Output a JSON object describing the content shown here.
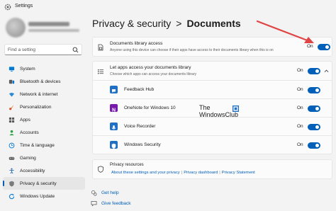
{
  "window": {
    "title": "Settings"
  },
  "search": {
    "placeholder": "Find a setting"
  },
  "nav": {
    "items": [
      {
        "label": "System",
        "icon": "monitor-icon"
      },
      {
        "label": "Bluetooth & devices",
        "icon": "bluetooth-icon"
      },
      {
        "label": "Network & internet",
        "icon": "wifi-icon"
      },
      {
        "label": "Personalization",
        "icon": "brush-icon"
      },
      {
        "label": "Apps",
        "icon": "apps-icon"
      },
      {
        "label": "Accounts",
        "icon": "person-icon"
      },
      {
        "label": "Time & language",
        "icon": "globe-clock-icon"
      },
      {
        "label": "Gaming",
        "icon": "gamepad-icon"
      },
      {
        "label": "Accessibility",
        "icon": "accessibility-icon"
      },
      {
        "label": "Privacy & security",
        "icon": "shield-icon",
        "active": true
      },
      {
        "label": "Windows Update",
        "icon": "update-icon"
      }
    ]
  },
  "breadcrumb": {
    "parent": "Privacy & security",
    "separator": ">",
    "current": "Documents"
  },
  "documents_access": {
    "title": "Documents library access",
    "description": "Anyone using this device can choose if their apps have access to their documents library when this is on",
    "state": "On"
  },
  "apps_access": {
    "title": "Let apps access your documents library",
    "description": "Choose which apps can access your documents library",
    "state": "On",
    "apps": [
      {
        "name": "Feedback Hub",
        "state": "On",
        "color": "#1f6fc4"
      },
      {
        "name": "OneNote for Windows 10",
        "state": "On",
        "color": "#7719aa"
      },
      {
        "name": "Voice Recorder",
        "state": "On",
        "color": "#1f6fc4"
      },
      {
        "name": "Windows Security",
        "state": "On",
        "color": "#1f6fc4"
      }
    ]
  },
  "privacy_resources": {
    "title": "Privacy resources",
    "links": [
      "About these settings and your privacy",
      "Privacy dashboard",
      "Privacy Statement"
    ]
  },
  "help": {
    "get_help": "Get help",
    "give_feedback": "Give feedback"
  },
  "watermark": {
    "line1": "The",
    "line2": "WindowsClub"
  },
  "colors": {
    "accent": "#005fb8",
    "arrow": "#e04545",
    "background": "#f3f3f3",
    "card": "#fbfbfb"
  }
}
